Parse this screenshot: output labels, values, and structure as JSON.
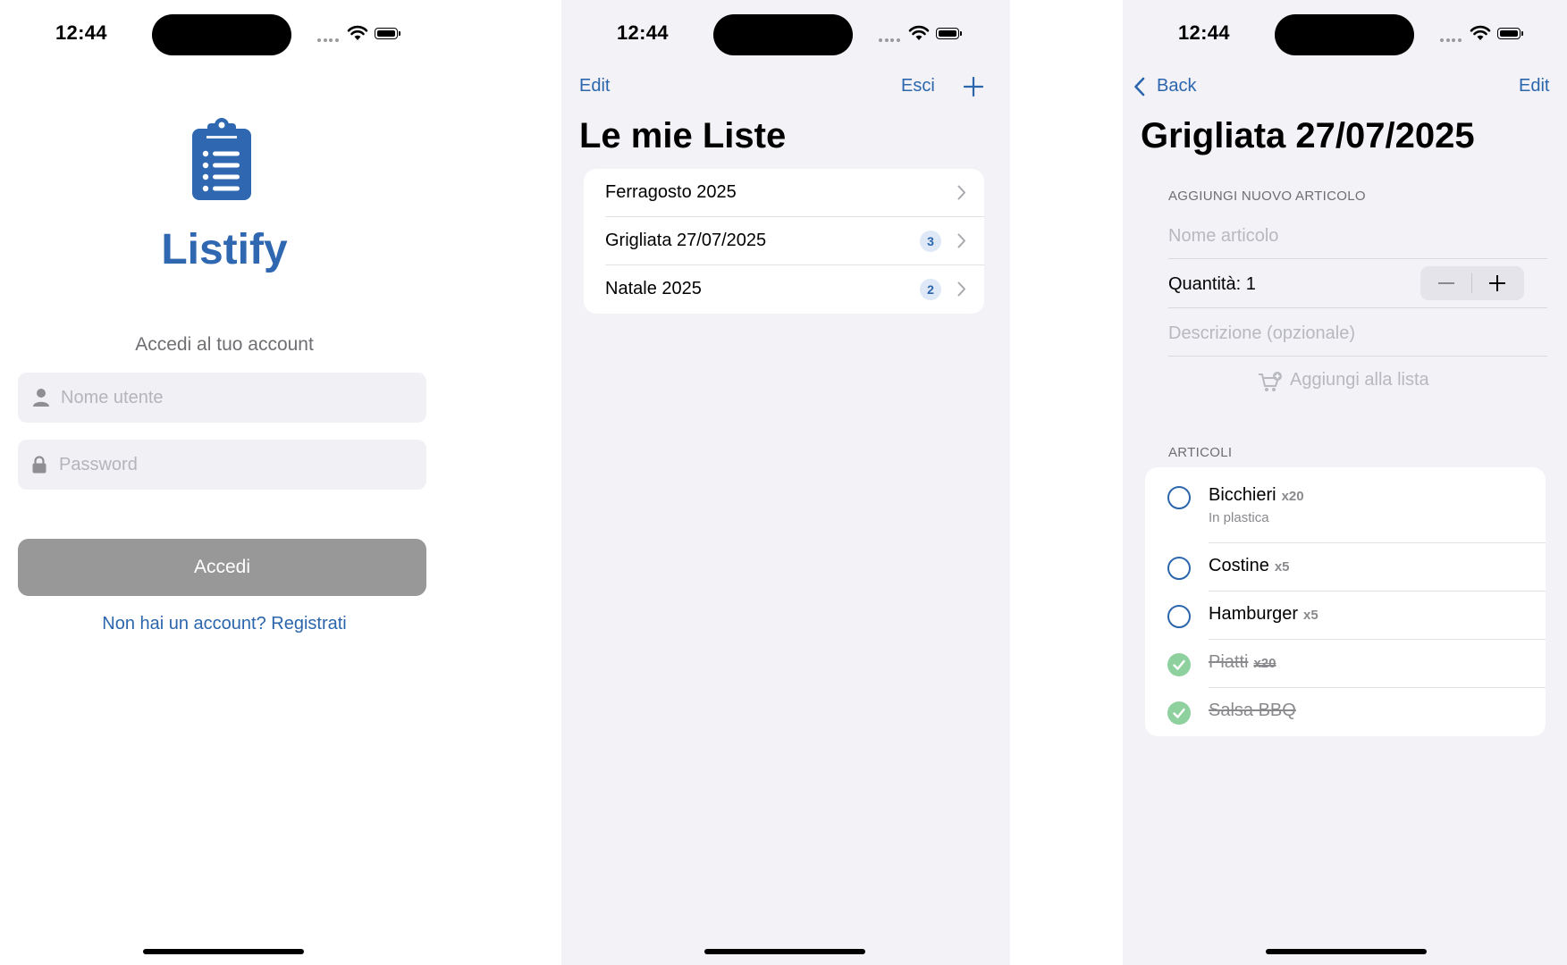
{
  "status_bar": {
    "time": "12:44"
  },
  "login": {
    "app_name": "Listify",
    "subtitle": "Accedi al tuo account",
    "username_placeholder": "Nome utente",
    "password_placeholder": "Password",
    "login_button": "Accedi",
    "register_link": "Non hai un account? Registrati"
  },
  "lists": {
    "edit": "Edit",
    "logout": "Esci",
    "title": "Le mie Liste",
    "items": [
      {
        "name": "Ferragosto 2025",
        "count": ""
      },
      {
        "name": "Grigliata 27/07/2025",
        "count": "3"
      },
      {
        "name": "Natale 2025",
        "count": "2"
      }
    ]
  },
  "detail": {
    "back": "Back",
    "edit": "Edit",
    "title": "Grigliata 27/07/2025",
    "add_section": "AGGIUNGI NUOVO ARTICOLO",
    "name_placeholder": "Nome articolo",
    "quantity_label": "Quantità: 1",
    "description_placeholder": "Descrizione (opzionale)",
    "add_button": "Aggiungi alla lista",
    "items_section": "ARTICOLI",
    "items": [
      {
        "name": "Bicchieri",
        "qty": "x20",
        "desc": "In plastica",
        "done": false
      },
      {
        "name": "Costine",
        "qty": "x5",
        "desc": "",
        "done": false
      },
      {
        "name": "Hamburger",
        "qty": "x5",
        "desc": "",
        "done": false
      },
      {
        "name": "Piatti",
        "qty": "x20",
        "desc": "",
        "done": true
      },
      {
        "name": "Salsa BBQ",
        "qty": "",
        "desc": "",
        "done": true
      }
    ]
  },
  "colors": {
    "accent": "#2b66ad",
    "logo": "#2f67b1",
    "done": "#8fd19e",
    "button_disabled": "#989898"
  }
}
